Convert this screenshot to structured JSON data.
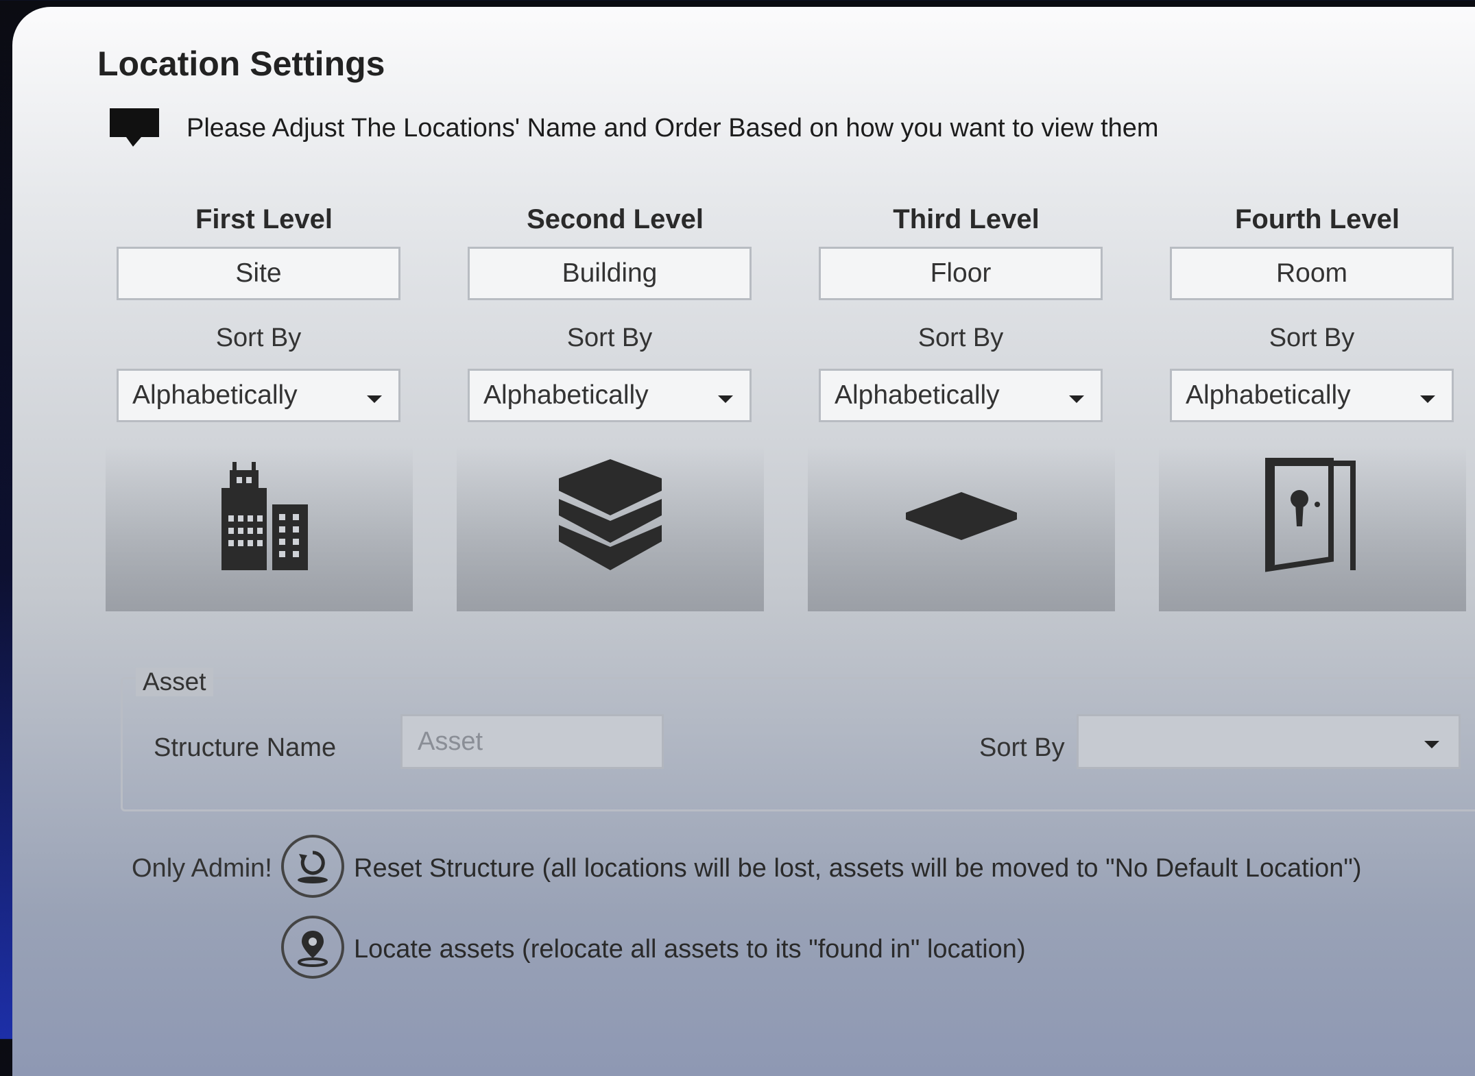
{
  "window": {
    "title": "Location Settings",
    "hint": "Please Adjust The Locations' Name and Order Based on how you want to view them"
  },
  "levels": [
    {
      "heading": "First Level",
      "name": "Site",
      "sort_label": "Sort By",
      "sort_value": "Alphabetically",
      "icon": "city-buildings-icon"
    },
    {
      "heading": "Second Level",
      "name": "Building",
      "sort_label": "Sort By",
      "sort_value": "Alphabetically",
      "icon": "layers-icon"
    },
    {
      "heading": "Third Level",
      "name": "Floor",
      "sort_label": "Sort By",
      "sort_value": "Alphabetically",
      "icon": "floor-plate-icon"
    },
    {
      "heading": "Fourth  Level",
      "name": "Room",
      "sort_label": "Sort By",
      "sort_value": "Alphabetically",
      "icon": "door-icon"
    }
  ],
  "asset": {
    "legend": "Asset",
    "structure_label": "Structure Name",
    "structure_placeholder": "Asset",
    "sort_label": "Sort By",
    "sort_value": ""
  },
  "admin": {
    "label": "Only Admin!",
    "reset_text": "Reset Structure (all locations will be lost, assets will be moved to \"No Default Location\")",
    "reset_icon": "reset-icon",
    "locate_text": "Locate assets (relocate all assets to its \"found in\" location)",
    "locate_icon": "location-pin-icon"
  }
}
